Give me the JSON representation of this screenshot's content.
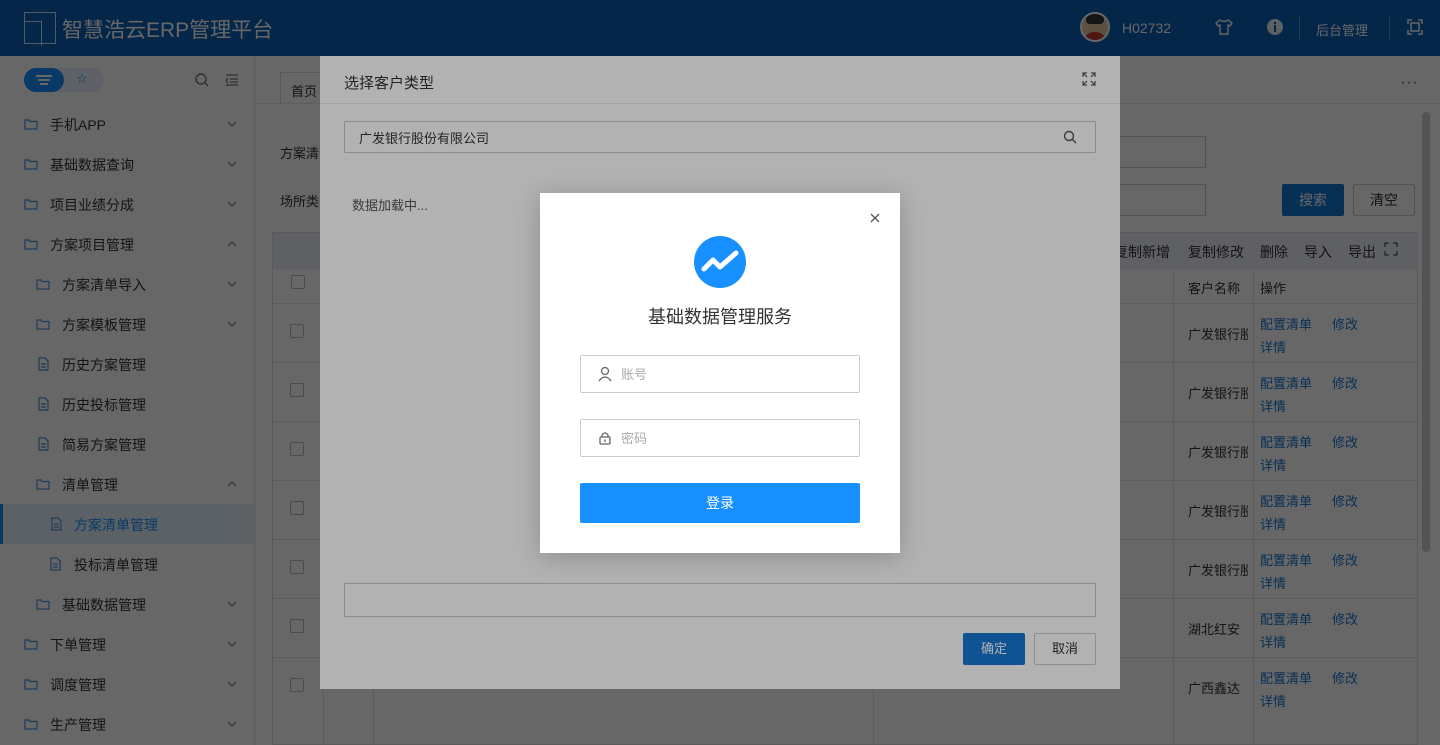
{
  "header": {
    "app_title": "智慧浩云ERP管理平台",
    "username": "H02732",
    "admin_label": "后台管理"
  },
  "sidebar": {
    "items": [
      {
        "label": "手机APP"
      },
      {
        "label": "基础数据查询"
      },
      {
        "label": "项目业绩分成"
      },
      {
        "label": "方案项目管理"
      },
      {
        "label": "方案清单导入"
      },
      {
        "label": "方案模板管理"
      },
      {
        "label": "历史方案管理"
      },
      {
        "label": "历史投标管理"
      },
      {
        "label": "简易方案管理"
      },
      {
        "label": "清单管理"
      },
      {
        "label": "方案清单管理"
      },
      {
        "label": "投标清单管理"
      },
      {
        "label": "基础数据管理"
      },
      {
        "label": "下单管理"
      },
      {
        "label": "调度管理"
      },
      {
        "label": "生产管理"
      }
    ]
  },
  "main": {
    "first_tab": "首页",
    "form": {
      "label1": "方案清",
      "label2": "场所类"
    },
    "search_button": "搜索",
    "clear_button": "清空",
    "toolbar": [
      "复制新增",
      "复制修改",
      "删除",
      "导入",
      "导出"
    ],
    "columns": {
      "customer": "客户名称",
      "operation": "操作"
    },
    "rows": [
      {
        "customer": "广发银行股份有限公司"
      },
      {
        "customer": "广发银行股份有限公司"
      },
      {
        "customer": "广发银行股份有限公司"
      },
      {
        "customer": "广发银行股份有限公司"
      },
      {
        "customer": "广发银行股份有限公司"
      },
      {
        "customer": "湖北红安"
      },
      {
        "customer": "广西鑫达"
      }
    ],
    "row_actions": {
      "config": "配置清单",
      "edit": "修改",
      "detail": "详情"
    }
  },
  "customer_dialog": {
    "title": "选择客户类型",
    "search_value": "广发银行股份有限公司",
    "loading_text": "数据加载中...",
    "ok_label": "确定",
    "cancel_label": "取消"
  },
  "login_modal": {
    "title": "基础数据管理服务",
    "account_placeholder": "账号",
    "password_placeholder": "密码",
    "login_label": "登录"
  },
  "colors": {
    "header_bg": "#0c5fb5",
    "primary": "#1890ff",
    "button_blue": "#1677d2"
  }
}
